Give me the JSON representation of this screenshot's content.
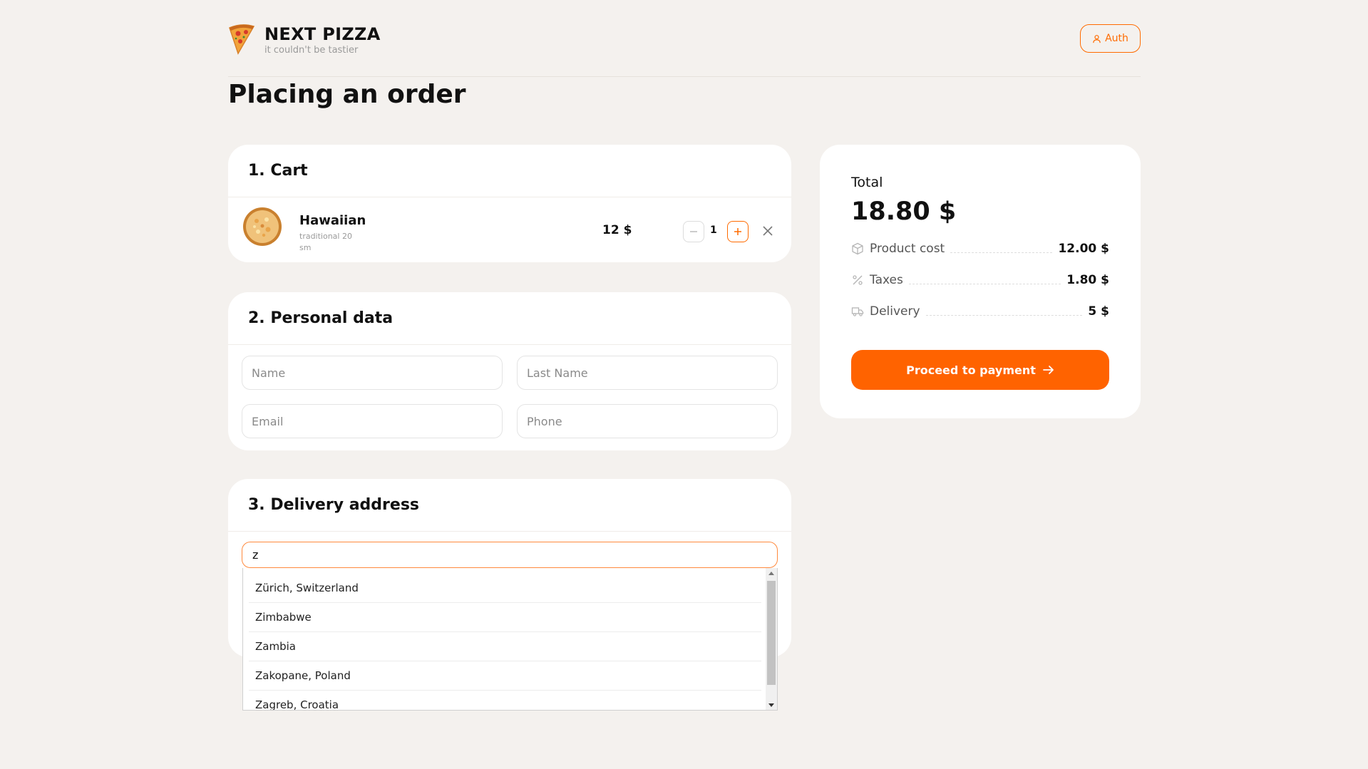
{
  "header": {
    "brand_name": "NEXT PIZZA",
    "brand_tagline": "it couldn't be tastier",
    "auth_label": "Auth"
  },
  "page_title": "Placing an order",
  "cart": {
    "title": "1. Cart",
    "items": [
      {
        "name": "Hawaiian",
        "description": "traditional 20 sm",
        "price": "12 $",
        "quantity": "1"
      }
    ]
  },
  "personal": {
    "title": "2. Personal data",
    "name_placeholder": "Name",
    "lastname_placeholder": "Last Name",
    "email_placeholder": "Email",
    "phone_placeholder": "Phone"
  },
  "delivery": {
    "title": "3. Delivery address",
    "address_value": "z",
    "suggestions": [
      "Zürich, Switzerland",
      "Zimbabwe",
      "Zambia",
      "Zakopane, Poland",
      "Zagreb, Croatia"
    ]
  },
  "summary": {
    "total_label": "Total",
    "total_value": "18.80 $",
    "product_cost_label": "Product cost",
    "product_cost_value": "12.00 $",
    "taxes_label": "Taxes",
    "taxes_value": "1.80 $",
    "delivery_label": "Delivery",
    "delivery_value": "5 $",
    "pay_label": "Proceed to payment"
  },
  "icons": {
    "logo": "pizza-slice-icon",
    "auth": "user-icon",
    "remove": "close-icon",
    "product_cost": "package-icon",
    "taxes": "percent-icon",
    "delivery": "truck-icon",
    "pay": "arrow-right-icon"
  },
  "colors": {
    "accent": "#ff6300",
    "background": "#f4f1ee"
  }
}
